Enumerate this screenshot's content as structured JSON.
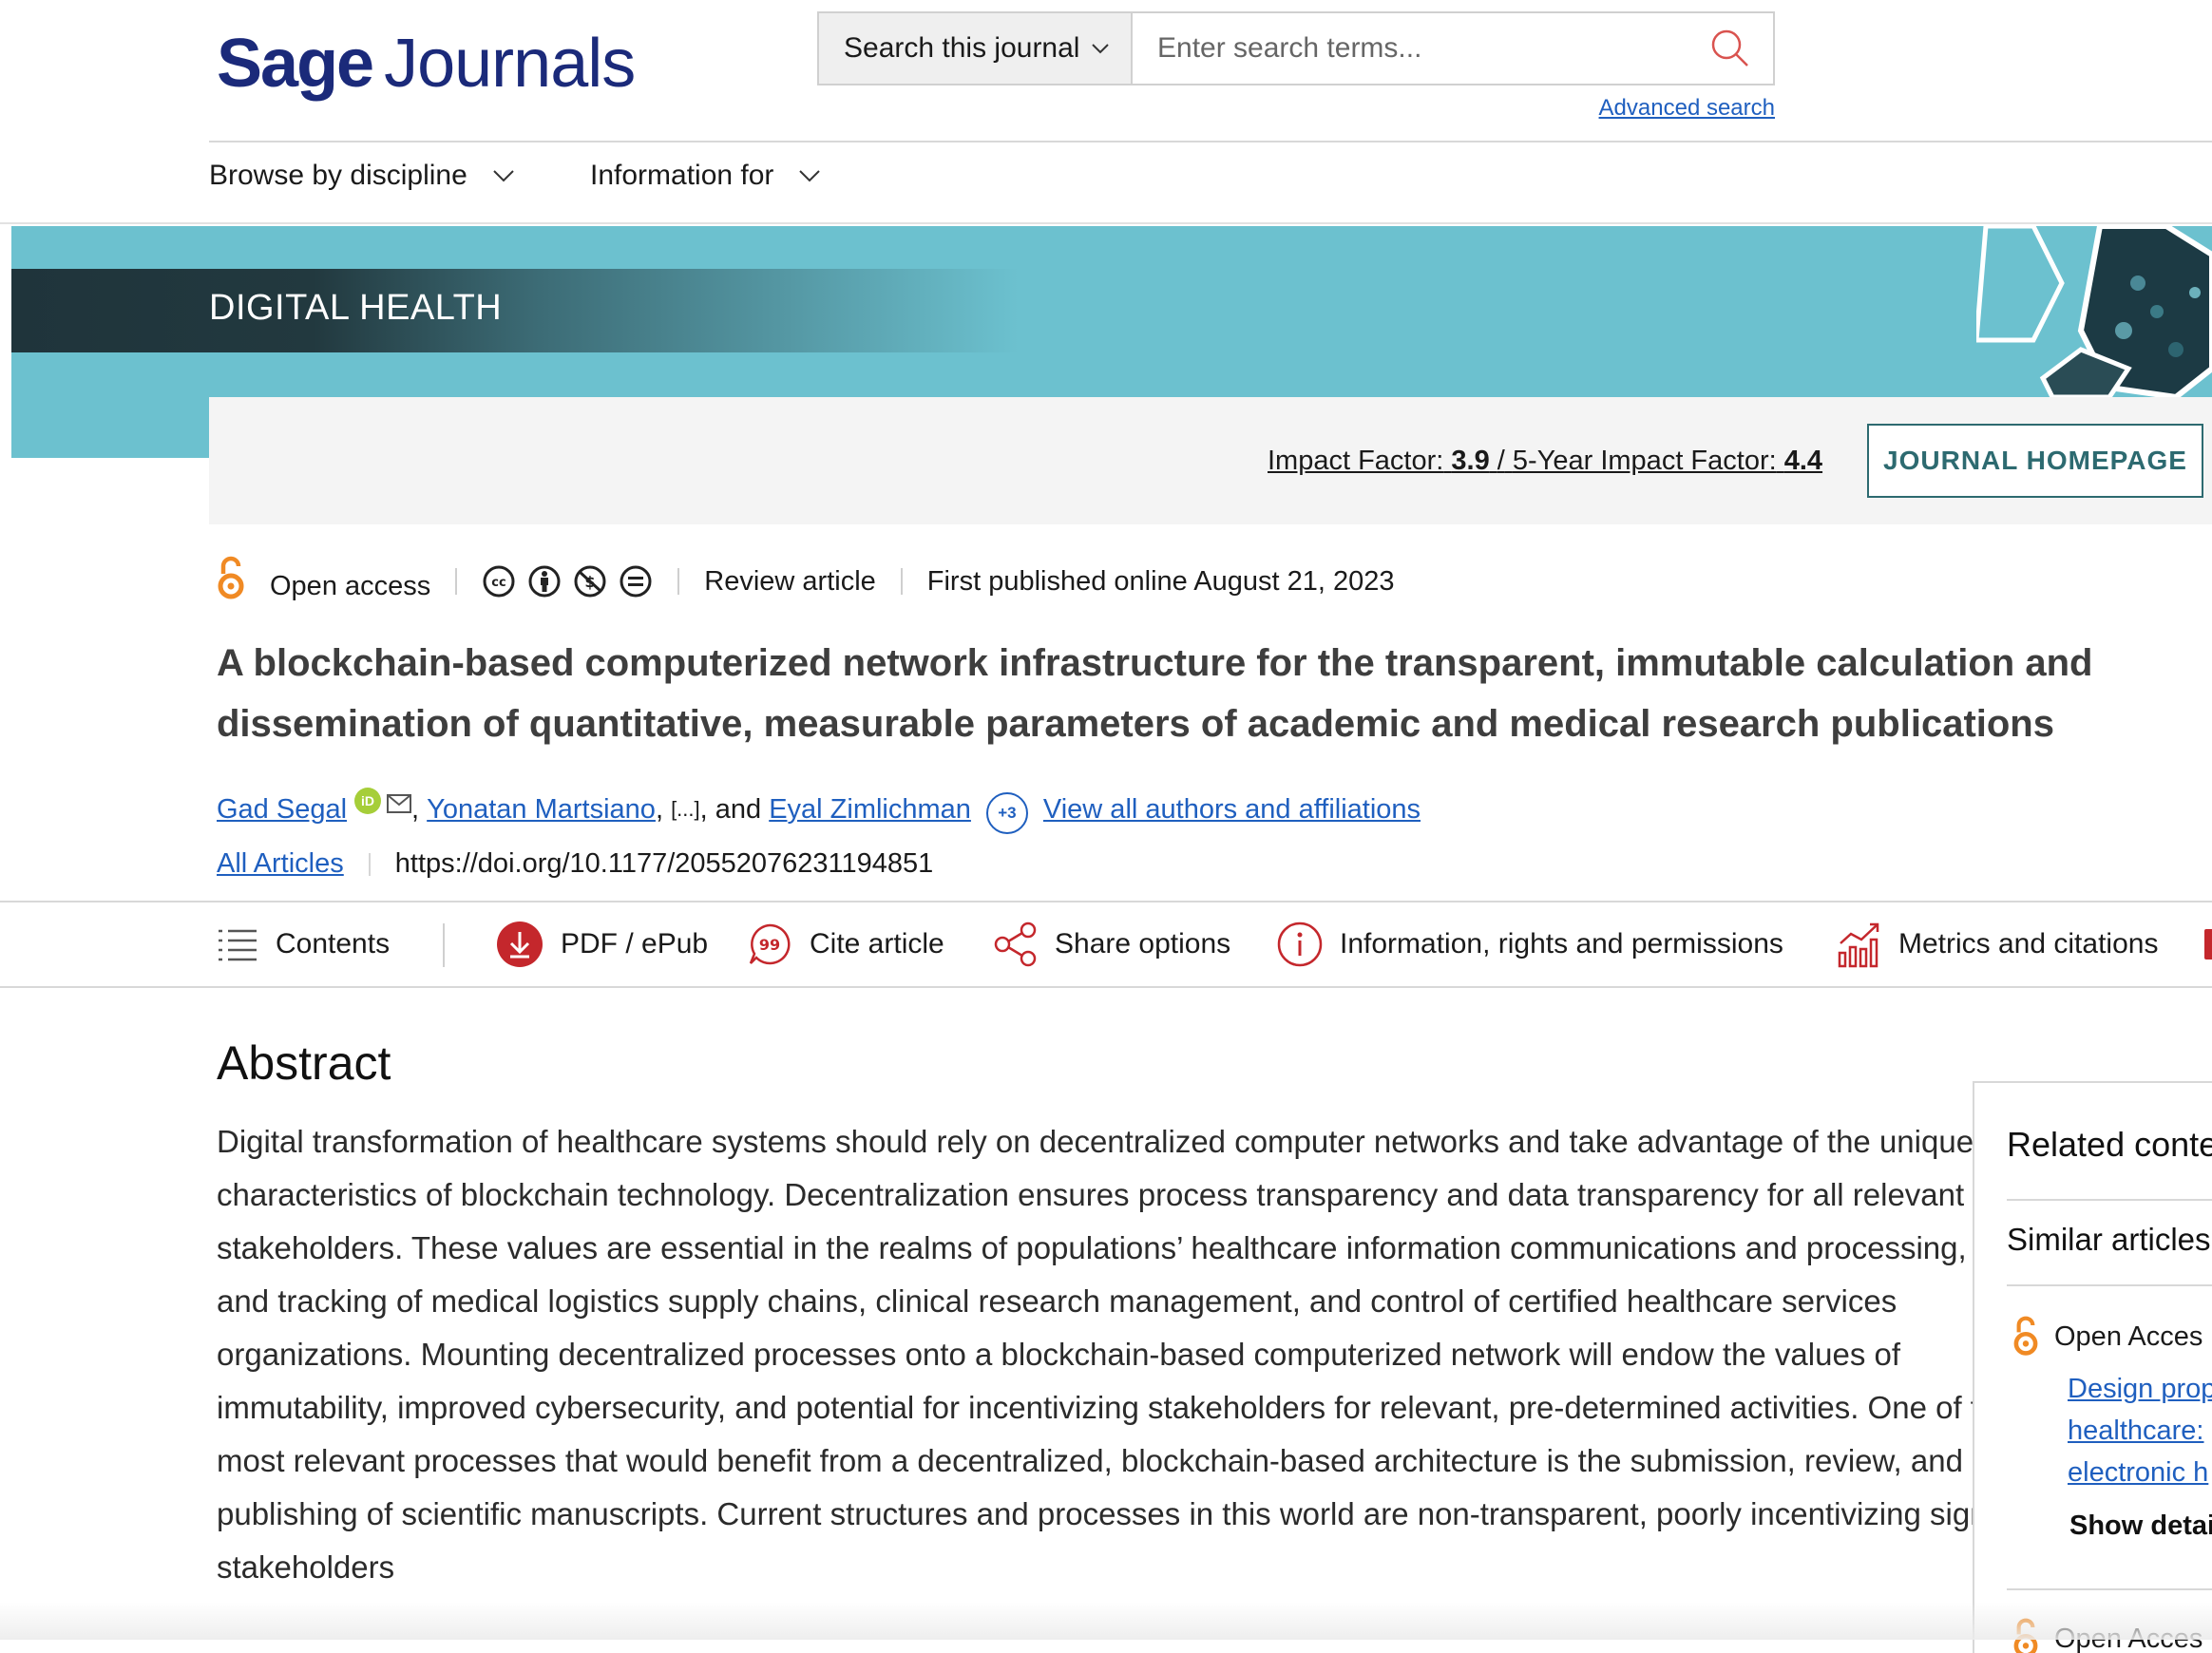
{
  "header": {
    "logo_sage": "Sage",
    "logo_journals": "Journals",
    "search_scope": "Search this journal",
    "search_placeholder": "Enter search terms...",
    "advanced_search": "Advanced search",
    "nav": [
      "Browse by discipline",
      "Information for"
    ]
  },
  "banner": {
    "journal_name": "DIGITAL HEALTH",
    "impact_factor_label": "Impact Factor:",
    "impact_factor_value": "3.9",
    "five_year_label": "5-Year Impact Factor:",
    "five_year_value": "4.4",
    "homepage_button": "JOURNAL HOMEPAGE"
  },
  "article": {
    "access": "Open access",
    "type": "Review article",
    "published": "First published online August 21, 2023",
    "title": "A blockchain-based computerized network infrastructure for the transparent, immutable calculation and dissemination of quantitative, measurable parameters of academic and medical research publications",
    "authors": [
      "Gad Segal",
      "Yonatan Martsiano",
      "Eyal Zimlichman"
    ],
    "ellipsis": "[...]",
    "and_text": "and",
    "more_authors": "+3",
    "view_all": "View all authors and affiliations",
    "all_articles": "All Articles",
    "doi": "https://doi.org/10.1177/20552076231194851"
  },
  "toolbar": {
    "contents": "Contents",
    "pdf": "PDF / ePub",
    "cite": "Cite article",
    "share": "Share options",
    "info": "Information, rights and permissions",
    "metrics": "Metrics and citations"
  },
  "abstract": {
    "heading": "Abstract",
    "text": "Digital transformation of healthcare systems should rely on decentralized computer networks and take advantage of the unique characteristics of blockchain technology. Decentralization ensures process transparency and data transparency for all relevant stakeholders. These values are essential in the realms of populations’ healthcare information communications and processing, control and tracking of medical logistics supply chains, clinical research management, and control of certified healthcare services organizations. Mounting decentralized processes onto a blockchain-based computerized network will endow the values of immutability, improved cybersecurity, and potential for incentivizing stakeholders for relevant, pre-determined activities. One of the most relevant processes that would benefit from a decentralized, blockchain-based architecture is the submission, review, and publishing of scientific manuscripts. Current structures and processes in this world are non-transparent, poorly incentivizing significant stakeholders"
  },
  "related": {
    "title": "Related conte",
    "similar": "Similar articles",
    "item_access": "Open Acces",
    "item_link_lines": [
      "Design prop",
      "healthcare:",
      "electronic h"
    ],
    "show_details": "Show detai",
    "item2_access": "Open Acces"
  },
  "colors": {
    "brand": "#1b2a7a",
    "link": "#1f5fbf",
    "banner_teal": "#6cc1cf",
    "banner_dark": "#1f343b",
    "button_teal": "#2d6a70",
    "open_access_orange": "#f08a24",
    "toolbar_red": "#c4272c"
  },
  "icons": [
    "chevron-down-icon",
    "search-icon",
    "open-access-icon",
    "cc-icon",
    "by-icon",
    "nc-icon",
    "nd-icon",
    "orcid-icon",
    "email-icon",
    "contents-icon",
    "pdf-download-icon",
    "cite-icon",
    "share-icon",
    "info-icon",
    "metrics-icon"
  ]
}
